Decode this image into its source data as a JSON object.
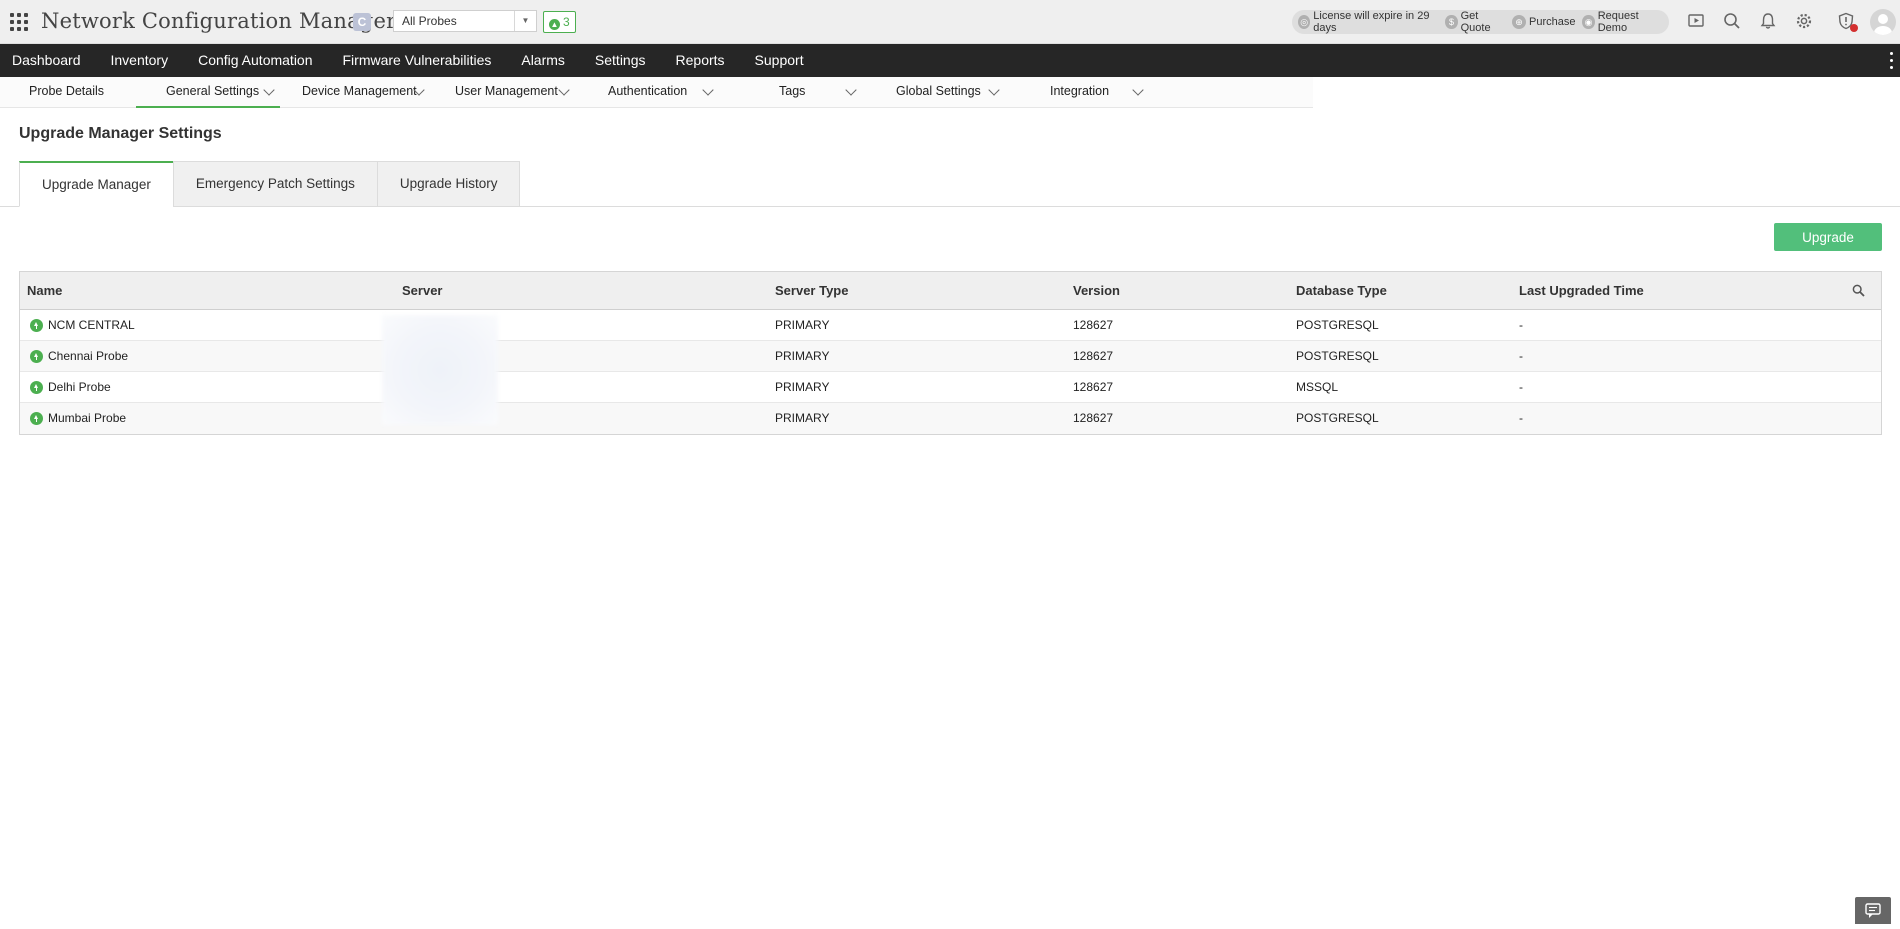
{
  "app": {
    "title": "Network Configuration Manager",
    "badge": "C",
    "probe_select": "All Probes",
    "probe_count": "3"
  },
  "license_bar": {
    "license": "License will expire in 29 days",
    "get_quote": "Get Quote",
    "purchase": "Purchase",
    "request_demo": "Request Demo"
  },
  "header_icons": [
    "video-icon",
    "search-icon",
    "bell-icon",
    "gear-icon",
    "alert-shield-icon",
    "user-avatar-icon"
  ],
  "main_nav": [
    {
      "label": "Dashboard"
    },
    {
      "label": "Inventory"
    },
    {
      "label": "Config Automation"
    },
    {
      "label": "Firmware Vulnerabilities"
    },
    {
      "label": "Alarms"
    },
    {
      "label": "Settings"
    },
    {
      "label": "Reports"
    },
    {
      "label": "Support"
    }
  ],
  "sub_nav": [
    {
      "label": "Probe Details"
    },
    {
      "label": "General Settings"
    },
    {
      "label": "Device Management"
    },
    {
      "label": "User Management"
    },
    {
      "label": "Authentication"
    },
    {
      "label": "Tags"
    },
    {
      "label": "Global Settings"
    },
    {
      "label": "Integration"
    }
  ],
  "page": {
    "title": "Upgrade Manager Settings",
    "tabs": [
      {
        "label": "Upgrade Manager"
      },
      {
        "label": "Emergency Patch Settings"
      },
      {
        "label": "Upgrade History"
      }
    ],
    "upgrade_button": "Upgrade"
  },
  "table": {
    "columns": [
      "Name",
      "Server",
      "Server Type",
      "Version",
      "Database Type",
      "Last Upgraded Time"
    ],
    "rows": [
      {
        "name": "NCM CENTRAL",
        "server": "",
        "server_type": "PRIMARY",
        "version": "128627",
        "db_type": "POSTGRESQL",
        "last_upgraded": "-"
      },
      {
        "name": "Chennai Probe",
        "server": "",
        "server_type": "PRIMARY",
        "version": "128627",
        "db_type": "POSTGRESQL",
        "last_upgraded": "-"
      },
      {
        "name": "Delhi Probe",
        "server": "",
        "server_type": "PRIMARY",
        "version": "128627",
        "db_type": "MSSQL",
        "last_upgraded": "-"
      },
      {
        "name": "Mumbai Probe",
        "server": "",
        "server_type": "PRIMARY",
        "version": "128627",
        "db_type": "POSTGRESQL",
        "last_upgraded": "-"
      }
    ]
  },
  "colors": {
    "accent_green": "#4caf50",
    "button_green": "#52bf7b",
    "nav_dark": "#262626"
  }
}
